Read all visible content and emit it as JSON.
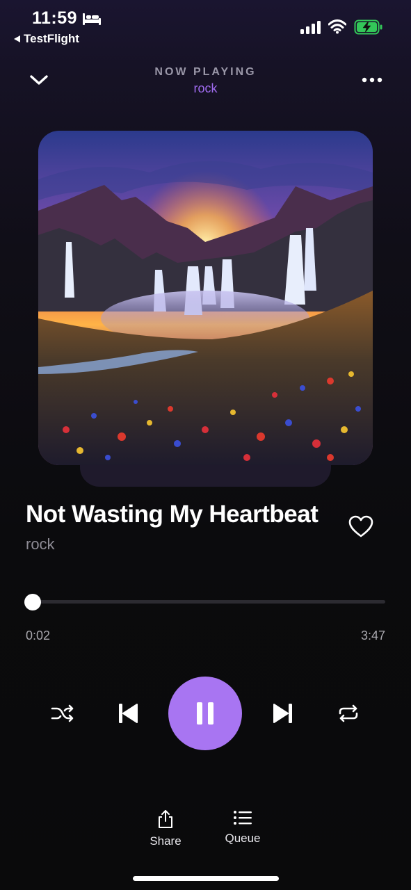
{
  "status_bar": {
    "time": "11:59",
    "back_app": "TestFlight",
    "icons": [
      "bed-icon",
      "cellular-signal-icon",
      "wifi-icon",
      "battery-charging-icon"
    ]
  },
  "header": {
    "label": "NOW PLAYING",
    "playlist": "rock",
    "icons": [
      "chevron-down-icon",
      "more-icon"
    ]
  },
  "track": {
    "title": "Not Wasting My Heartbeat",
    "artist": "rock",
    "favorited": false
  },
  "progress": {
    "elapsed": "0:02",
    "duration": "3:47",
    "fraction": 0.009
  },
  "controls": {
    "state": "playing",
    "icons": [
      "shuffle-icon",
      "skip-previous-icon",
      "pause-icon",
      "skip-next-icon",
      "repeat-icon"
    ]
  },
  "actions": {
    "share_label": "Share",
    "queue_label": "Queue"
  },
  "colors": {
    "accent": "#a875f2",
    "playlist_text": "#a06cf0",
    "background": "#0b0b0d"
  }
}
